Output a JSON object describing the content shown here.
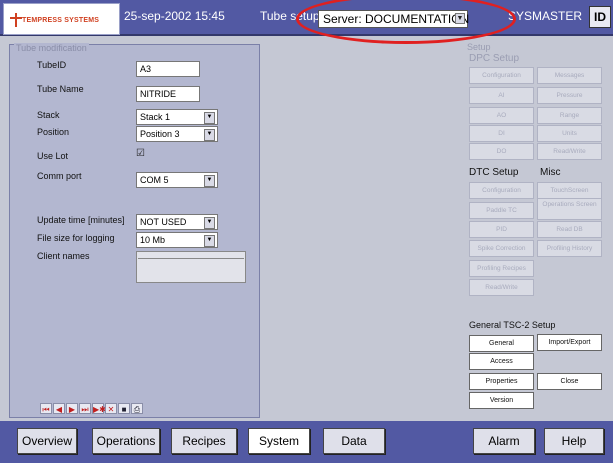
{
  "header": {
    "logo_text": "TEMPRESS SYSTEMS",
    "datetime": "25-sep-2002 15:45",
    "page_title": "Tube setup",
    "server_value": "Server: DOCUMENTATION",
    "user": "SYSMASTER",
    "id_label": "ID"
  },
  "tube_mod": {
    "legend": "Tube modification",
    "tubeid_label": "TubeID",
    "tubeid_value": "A3",
    "tubename_label": "Tube Name",
    "tubename_value": "NITRIDE",
    "stack_label": "Stack",
    "stack_value": "Stack 1",
    "position_label": "Position",
    "position_value": "Position 3",
    "uselot_label": "Use Lot",
    "uselot_checked": true,
    "uselot_mark": "☑",
    "commport_label": "Comm port",
    "commport_value": "COM 5",
    "update_label": "Update time [minutes]",
    "update_value": "NOT USED",
    "filesize_label": "File size for logging",
    "filesize_value": "10 Mb",
    "clientnames_label": "Client names",
    "nav_icons": [
      "first-icon",
      "prev-icon",
      "next-icon",
      "last-icon",
      "new-record-icon",
      "delete-icon",
      "save-icon",
      "print-icon"
    ],
    "nav_glyphs": [
      "⏮",
      "◀",
      "▶",
      "⏭",
      "▶✱",
      "✕",
      "■",
      "⎙"
    ]
  },
  "setup": {
    "title": "Setup",
    "dpc_title": "DPC Setup",
    "dpc_buttons": [
      "Configuration",
      "Messages",
      "AI",
      "Pressure",
      "AO",
      "Range",
      "DI",
      "Units",
      "DO",
      "Read/Write"
    ],
    "dtc_title": "DTC Setup",
    "misc_title": "Misc",
    "dtc_buttons": [
      "Configuration",
      "Paddle TC",
      "PID",
      "Spike Correction",
      "Profiling Recipes",
      "Read/Write"
    ],
    "misc_buttons": [
      "TouchScreen",
      "Operations Screen",
      "Read DB",
      "Profiling History"
    ],
    "general_title": "General TSC-2 Setup",
    "general_buttons": [
      "General",
      "Access",
      "Properties",
      "Version"
    ],
    "import_export": "Import/Export",
    "close": "Close"
  },
  "tabs": [
    "Overview",
    "Operations",
    "Recipes",
    "System",
    "Data",
    "Alarm",
    "Help"
  ],
  "active_tab": "System",
  "colors": {
    "header_bg": "#5259a3",
    "panel_bg": "#b3b7d0",
    "annotation": "#e02020"
  }
}
